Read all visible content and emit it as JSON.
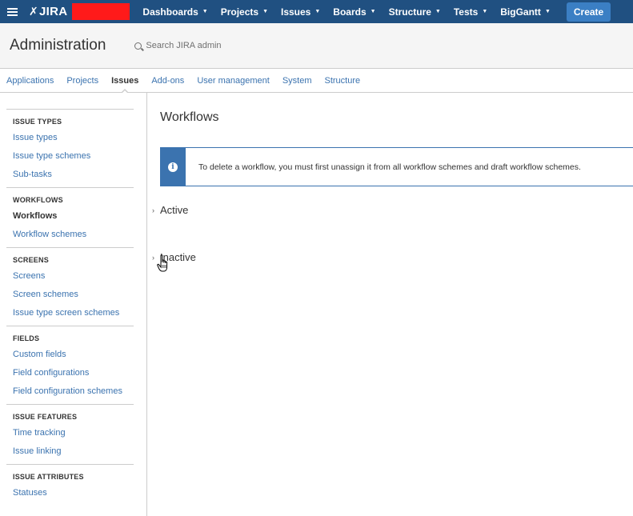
{
  "topnav": {
    "logo": "JIRA",
    "items": [
      {
        "label": "Dashboards"
      },
      {
        "label": "Projects"
      },
      {
        "label": "Issues"
      },
      {
        "label": "Boards"
      },
      {
        "label": "Structure"
      },
      {
        "label": "Tests"
      },
      {
        "label": "BigGantt"
      }
    ],
    "create_label": "Create",
    "colors": {
      "bar": "#205081",
      "create": "#3b7fc4",
      "redacted": "#ff1a1a"
    }
  },
  "admin": {
    "title": "Administration",
    "search_label": "Search JIRA admin"
  },
  "tabs": [
    {
      "label": "Applications"
    },
    {
      "label": "Projects"
    },
    {
      "label": "Issues",
      "active": true
    },
    {
      "label": "Add-ons"
    },
    {
      "label": "User management"
    },
    {
      "label": "System"
    },
    {
      "label": "Structure"
    }
  ],
  "sidebar": {
    "groups": [
      {
        "heading": "ISSUE TYPES",
        "items": [
          "Issue types",
          "Issue type schemes",
          "Sub-tasks"
        ]
      },
      {
        "heading": "WORKFLOWS",
        "items": [
          "Workflows",
          "Workflow schemes"
        ]
      },
      {
        "heading": "SCREENS",
        "items": [
          "Screens",
          "Screen schemes",
          "Issue type screen schemes"
        ]
      },
      {
        "heading": "FIELDS",
        "items": [
          "Custom fields",
          "Field configurations",
          "Field configuration schemes"
        ]
      },
      {
        "heading": "ISSUE FEATURES",
        "items": [
          "Time tracking",
          "Issue linking"
        ]
      },
      {
        "heading": "ISSUE ATTRIBUTES",
        "items": [
          "Statuses"
        ]
      }
    ],
    "active_item": "Workflows"
  },
  "main": {
    "title": "Workflows",
    "message": "To delete a workflow, you must first unassign it from all workflow schemes and draft workflow schemes.",
    "sections": [
      {
        "label": "Active"
      },
      {
        "label": "Inactive"
      }
    ]
  }
}
